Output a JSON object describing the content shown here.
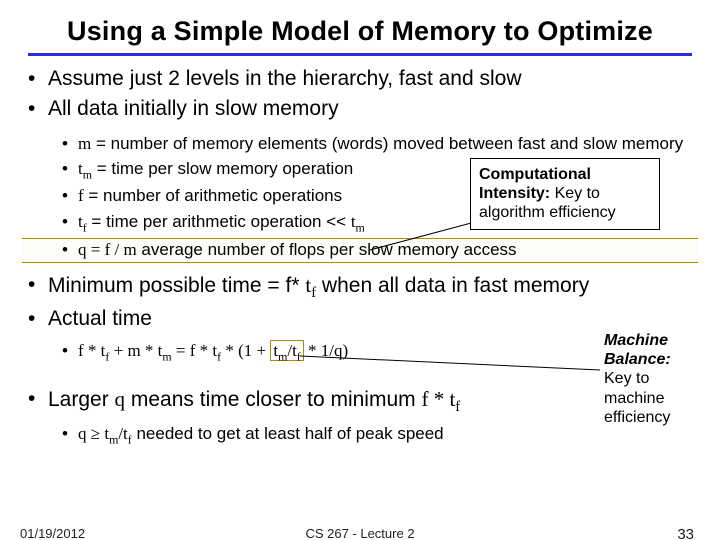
{
  "title": "Using a Simple Model of Memory to Optimize",
  "bul": {
    "a1": "Assume just 2 levels in the hierarchy, fast and slow",
    "a2": "All data initially in slow memory",
    "s1a": "m",
    "s1b": " = number of memory elements (words) moved between fast and slow memory",
    "s2a": "t",
    "s2b": " = time per slow memory operation",
    "s3a": "f",
    "s3b": " = number of arithmetic operations",
    "s4a": "t",
    "s4b": " = time per arithmetic operation << ",
    "s4c": "t",
    "s5a": "q = f / m",
    "s5b": "  average number of flops per slow memory access",
    "a3a": "Minimum possible time = f* ",
    "a3b": "t",
    "a3c": " when all data in fast memory",
    "a4": "Actual time",
    "s6a": "f * t",
    "s6b": " + m * t",
    "s6c": " = f * t",
    "s6d": " * (1 + ",
    "s6e": "t",
    "s6f": "/t",
    "s6g": " * 1/q)",
    "a5a": "Larger ",
    "a5b": "q",
    "a5c": " means time closer to minimum ",
    "a5d": "f * t",
    "s7a": "q ≥ t",
    "s7b": "/t",
    "s7c": "  needed to get at least half of peak speed",
    "sub_m": "m",
    "sub_f": "f"
  },
  "call1": {
    "line1": "Computational Intensity:",
    "line2": " Key to algorithm efficiency"
  },
  "call2": {
    "line1": "Machine Balance:",
    "line2": " Key to machine efficiency"
  },
  "footer": {
    "date": "01/19/2012",
    "mid": "CS 267 - Lecture 2",
    "num": "33"
  }
}
